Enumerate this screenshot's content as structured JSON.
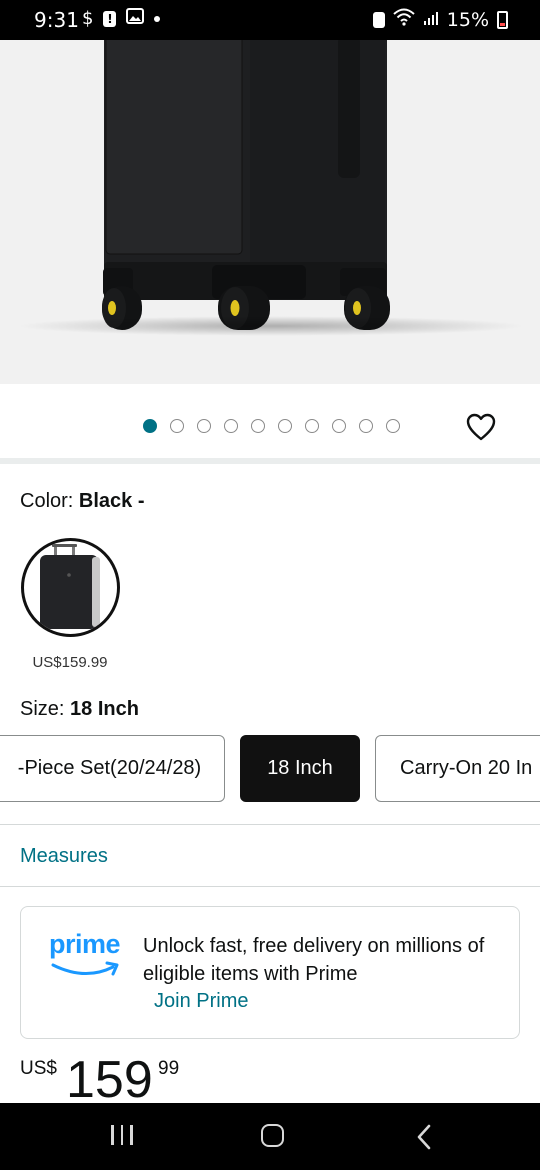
{
  "status_bar": {
    "time": "9:31",
    "battery_percent": "15%",
    "icons_left": [
      "dollar-icon",
      "alert-icon",
      "image-icon",
      "dot-icon"
    ],
    "icons_right": [
      "nfc-icon",
      "wifi-icon",
      "signal-icon",
      "battery-icon"
    ]
  },
  "product_image": {
    "subject": "black suitcase with yellow-hub spinner wheels",
    "colors": {
      "background": "#f1f1f1",
      "suitcase": "#1e1f21",
      "wheel_hub": "#e0c31f"
    }
  },
  "carousel": {
    "image_count": 10,
    "active_index": 0,
    "favorite_icon": "heart-icon"
  },
  "color_selector": {
    "label": "Color: ",
    "value": "Black -",
    "swatches": [
      {
        "name": "Black",
        "price": "US$159.99",
        "selected": true
      }
    ]
  },
  "size_selector": {
    "label": "Size: ",
    "value": "18 Inch",
    "options": [
      {
        "label": "-Piece Set(20/24/28)",
        "selected": false
      },
      {
        "label": "18 Inch",
        "selected": true
      },
      {
        "label": "Carry-On 20 In",
        "selected": false
      }
    ]
  },
  "measures_link": "Measures",
  "prime": {
    "logo_text": "prime",
    "message": "Unlock fast, free delivery on millions of eligible items with Prime",
    "join_label": "Join Prime",
    "colors": {
      "logo": "#1a98ff",
      "link": "#007185"
    }
  },
  "price": {
    "currency": "US$",
    "whole": "159",
    "fraction": "99"
  },
  "nav_bar": {
    "buttons": [
      "recent-apps-icon",
      "home-icon",
      "back-icon"
    ]
  },
  "colors": {
    "accent_teal": "#007185",
    "text": "#0f1111",
    "selected_button": "#111111"
  }
}
